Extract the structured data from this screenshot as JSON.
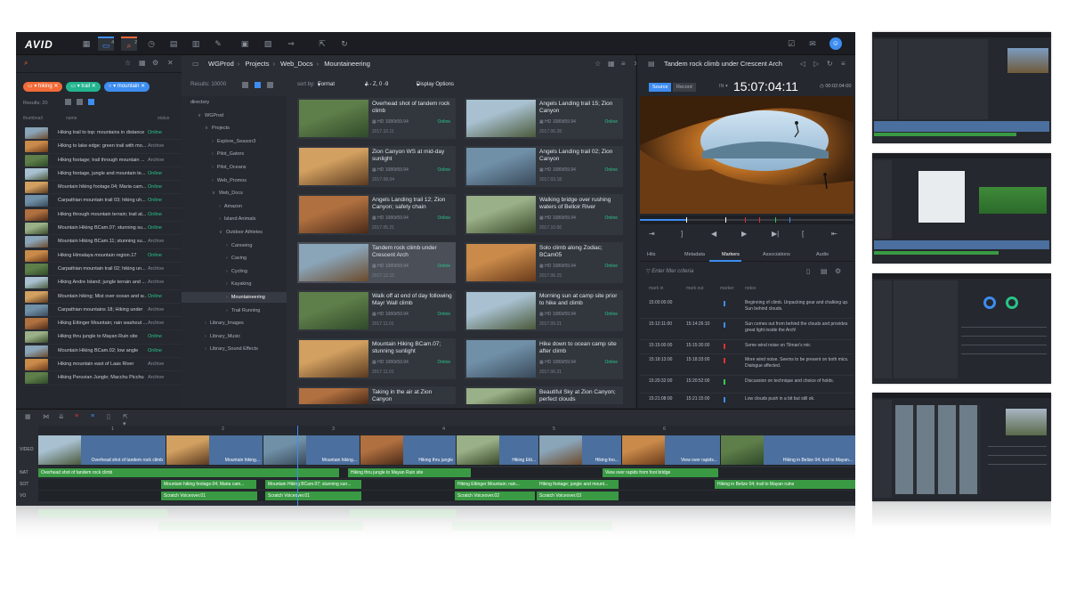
{
  "app": {
    "logo": "AVID"
  },
  "toolbar": {
    "badges": [
      "4",
      "2"
    ]
  },
  "search": {
    "chips": [
      {
        "label": "hiking",
        "color": "#f26b38"
      },
      {
        "label": "trail",
        "color": "#23b58f"
      },
      {
        "label": "mountain",
        "color": "#3d8df0"
      }
    ],
    "results": "Results: 20",
    "columns": {
      "thumbnail": "thumbnail",
      "name": "name",
      "status": "status"
    },
    "rows": [
      {
        "name": "Hiking trail to top: mountains in distance",
        "status": "Online"
      },
      {
        "name": "Hiking to lake edge: green trail with mo...",
        "status": "Archive"
      },
      {
        "name": "Hiking footage; trail through mountain ...",
        "status": "Archive"
      },
      {
        "name": "Hiking footage, jungle and mountain te...",
        "status": "Online"
      },
      {
        "name": "Mountain hiking footage.04; Maria cam...",
        "status": "Online"
      },
      {
        "name": "Carpathian mountain trail 03; hiking uh...",
        "status": "Online"
      },
      {
        "name": "Hiking through mountain terrain; trail at...",
        "status": "Online"
      },
      {
        "name": "Mountain Hiking BCam.07; stunning su...",
        "status": "Online"
      },
      {
        "name": "Mountain Hiking BCam.11; stunning su...",
        "status": "Archive"
      },
      {
        "name": "Hiking Himalaya mountain region.17",
        "status": "Online"
      },
      {
        "name": "Carpathian mountain trail 02; hiking un...",
        "status": "Archive"
      },
      {
        "name": "Hiking Andre Island; jungle terrain and ...",
        "status": "Archive"
      },
      {
        "name": "Mountain hiking; Mist over ocean and w...",
        "status": "Online"
      },
      {
        "name": "Carpathian mountains 18; Hiking under",
        "status": "Archive"
      },
      {
        "name": "Hiking Ettinger Mountain; rain washout ...",
        "status": "Archive"
      },
      {
        "name": "Hiking thru jungle to Mayan Ruin site",
        "status": "Online"
      },
      {
        "name": "Mountain Hiking BCam.02; low angle",
        "status": "Online"
      },
      {
        "name": "Hiking mountain east of Laas River",
        "status": "Archive"
      },
      {
        "name": "Hiking Peruvian Jungle; Macchu Picchu",
        "status": "Archive"
      }
    ]
  },
  "browse": {
    "crumbs": [
      "WGProd",
      "Projects",
      "Web_Docs",
      "Mountaineering"
    ],
    "results": "Results: 10000",
    "sort_by": "sort by:",
    "format": "Format",
    "order": "A - Z, 0 -9",
    "display": "Display Options",
    "tree": [
      "directory",
      "WGProd",
      "Projects",
      "Explore_Season3",
      "Pilot_Gators",
      "Pilot_Oceans",
      "Web_Promos",
      "Web_Docs",
      "Amazon",
      "Island Animals",
      "Outdoor Athletes",
      "Canoeing",
      "Caving",
      "Cycling",
      "Kayaking",
      "Mountaineering",
      "Trail Running",
      "Library_Images",
      "Library_Music",
      "Library_Sound Effects"
    ],
    "format_tag": "HD 1080i/59.94",
    "cards": [
      {
        "title": "Overhead shot of tandem rock climb",
        "date": "2017.10.11",
        "status": "Online"
      },
      {
        "title": "Angels Landing trail 15; Zion Canyon",
        "date": "2017.06.28",
        "status": "Online"
      },
      {
        "title": "Zion Canyon WS at mid-day sunlight",
        "date": "2017.08.04",
        "status": "Online"
      },
      {
        "title": "Angels Landing trail 02; Zion Canyon",
        "date": "2017.03.18",
        "status": "Online"
      },
      {
        "title": "Angels Landing trail 12; Zion Canyon; safety chain",
        "date": "2017.05.21",
        "status": "Online"
      },
      {
        "title": "Walking bridge over rushing waters of Belloir River",
        "date": "2017.10.06",
        "status": "Online"
      },
      {
        "title": "Tandem rock climb under Crescent Arch",
        "date": "2017.12.15",
        "status": "Online"
      },
      {
        "title": "Solo climb along Zodiac; BCam05",
        "date": "2017.06.15",
        "status": "Online"
      },
      {
        "title": "Walk off at end of day following Mayr Wall climb",
        "date": "2017.11.01",
        "status": "Online"
      },
      {
        "title": "Morning sun at camp site prior to hike and climb",
        "date": "2017.09.21",
        "status": "Online"
      },
      {
        "title": "Mountain Hiking BCam.07; stunning sunlight",
        "date": "2017.11.01",
        "status": "Online"
      },
      {
        "title": "Hike down to ocean camp site after climb",
        "date": "2017.06.21",
        "status": "Online"
      },
      {
        "title": "Taking in the air at Zion Canyon",
        "date": "",
        "status": ""
      },
      {
        "title": "Beautiful Sky at Zion Canyon; perfect clouds",
        "date": "",
        "status": ""
      }
    ]
  },
  "player": {
    "title": "Tandem rock climb under Crescent Arch",
    "source": "Source",
    "record": "Record",
    "in_label": "IN",
    "timecode": "15:07:04:11",
    "duration": "00:02:04:00",
    "tabs": [
      "Hits",
      "Metadata",
      "Markers",
      "Associations",
      "Audio"
    ],
    "filter_placeholder": "Enter filter criteria",
    "marker_columns": {
      "mark_in": "mark in",
      "mark_out": "mark out",
      "marker": "marker",
      "notes": "notes"
    },
    "markers": [
      {
        "in": "15:00:00:00",
        "out": "",
        "color": "#3d8df0",
        "note": "Beginning of climb. Unpacking gear and chalking up. Sun behind clouds."
      },
      {
        "in": "15:12:11:00",
        "out": "15:14:26:10",
        "color": "#3d8df0",
        "note": "Sun comes out from behind the clouds and provides great light inside the Arch!"
      },
      {
        "in": "15:15:00:00",
        "out": "15:15:30:00",
        "color": "#e0322f",
        "note": "Some wind noise on Tilman's mic"
      },
      {
        "in": "15:18:13:00",
        "out": "15:18:33:00",
        "color": "#e0322f",
        "note": "More wind noise. Seems to be present on both mics. Dialogue affected."
      },
      {
        "in": "15:20:32:00",
        "out": "15:20:52:00",
        "color": "#3ac84e",
        "note": "Discussion on technique and choice of holds."
      },
      {
        "in": "15:21:08:00",
        "out": "15:21:15:00",
        "color": "#3d8df0",
        "note": "Low clouds push in a bit but still ok."
      }
    ]
  },
  "timeline": {
    "ruler": [
      "1",
      "2",
      "3",
      "4",
      "5",
      "6"
    ],
    "track_labels": {
      "video": "VIDEO",
      "nat": "NAT",
      "sot": "SOT",
      "vo": "VO"
    },
    "video_clips": [
      {
        "name": "Overhead shot of tandem rock climb"
      },
      {
        "name": "Mountain hiking..."
      },
      {
        "name": "Mountain hiking..."
      },
      {
        "name": "Hiking thru jungle"
      },
      {
        "name": "Hiking Etti..."
      },
      {
        "name": "Hiking foo..."
      },
      {
        "name": "View over rapids..."
      },
      {
        "name": "Hiking in Belize 04; trail to Mayan..."
      }
    ],
    "nat_clips": [
      {
        "name": "Overhead shot of tandem rock climb"
      },
      {
        "name": "Hiking thru jungle to Mayan Ruin site"
      },
      {
        "name": "View over rapids from foot bridge"
      }
    ],
    "sot_clips": [
      {
        "name": "Mountain hiking footage.04; Maria cam..."
      },
      {
        "name": "Mountain Hiking BCam.07; stunning sun..."
      },
      {
        "name": "Hiking Ettinger Mountain; rain..."
      },
      {
        "name": "Hiking footage; jungle and mount..."
      },
      {
        "name": "Hiking in Belize 04; trail to Mayan ruins"
      }
    ],
    "vo_clips": [
      {
        "name": "Scratch Voiceover.01"
      },
      {
        "name": "Scratch Voiceover.01"
      },
      {
        "name": "Scratch Voiceover.02"
      },
      {
        "name": "Scratch Voiceover.03"
      }
    ]
  },
  "colors": {
    "accent": "#3d8df0",
    "online": "#29c48a",
    "clip_video": "#4b6f9e",
    "clip_audio": "#3a9a44"
  }
}
